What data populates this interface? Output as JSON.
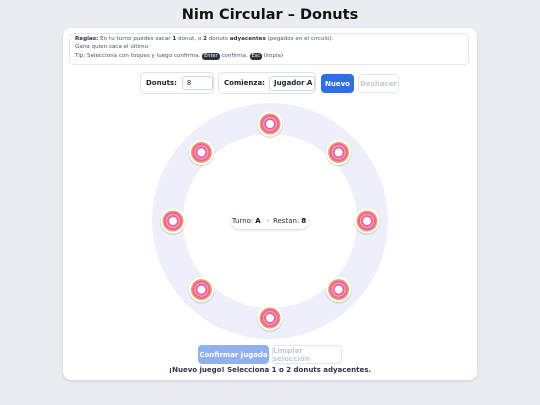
{
  "title": "Nim Circular – Donuts",
  "rules": {
    "line1_prefix": "Reglas:",
    "line1_a": " En tu turno puedes sacar ",
    "line1_b": "1",
    "line1_c": " donut, o ",
    "line1_d": "2",
    "line1_e": " donuts ",
    "line1_f": "adyacentes",
    "line1_g": " (pegados en el círculo).",
    "line2": "Gana quien saca el último.",
    "line3_a": "Tip: Selecciona con toques y luego confirma. ",
    "line3_key1": "Enter",
    "line3_b": " confirma, ",
    "line3_key2": "Esc",
    "line3_c": " limpia)"
  },
  "controls": {
    "donuts_label": "Donuts:",
    "donuts_value": "8",
    "start_label": "Comienza:",
    "start_value": "Jugador A",
    "new_label": "Nuevo",
    "undo_label": "Deshacer"
  },
  "board": {
    "donut_count": 8,
    "ring_color": "#edf0fb",
    "donut_color": "#f05f98",
    "icing_color": "#e8508c"
  },
  "center": {
    "turn_label": "Turno:",
    "turn_value": "A",
    "sep": "·",
    "remaining_label": "Restan:",
    "remaining_value": "8"
  },
  "actions": {
    "confirm_label": "Confirmar jugada",
    "clear_label": "Limpiar selección"
  },
  "status": "¡Nuevo juego! Selecciona 1 o 2 donuts adyacentes."
}
